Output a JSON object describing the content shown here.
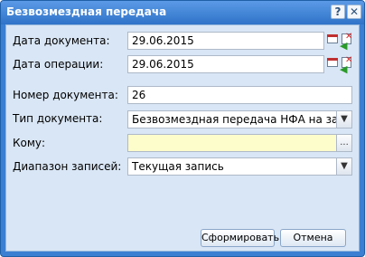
{
  "window": {
    "title": "Безвозмездная передача",
    "help_glyph": "?",
    "close_glyph": "✕"
  },
  "form": {
    "document_date": {
      "label": "Дата документа:",
      "value": "29.06.2015"
    },
    "operation_date": {
      "label": "Дата операции:",
      "value": "29.06.2015"
    },
    "document_number": {
      "label": "Номер документа:",
      "value": "26"
    },
    "document_type": {
      "label": "Тип документа:",
      "value": "Безвозмездная передача НФА на забалансо"
    },
    "recipient": {
      "label": "Кому:",
      "value": ""
    },
    "record_range": {
      "label": "Диапазон записей:",
      "value": "Текущая запись"
    }
  },
  "buttons": {
    "generate": "Сформировать",
    "cancel": "Отмена",
    "lookup": "..."
  },
  "icons": {
    "dropdown": "chevron-down-icon",
    "calendar": "calendar-icon",
    "clear": "clear-date-icon"
  },
  "colors": {
    "titlebar": "#2f73c8",
    "panel": "#d9e6f5",
    "required_field": "#fdfccb"
  }
}
